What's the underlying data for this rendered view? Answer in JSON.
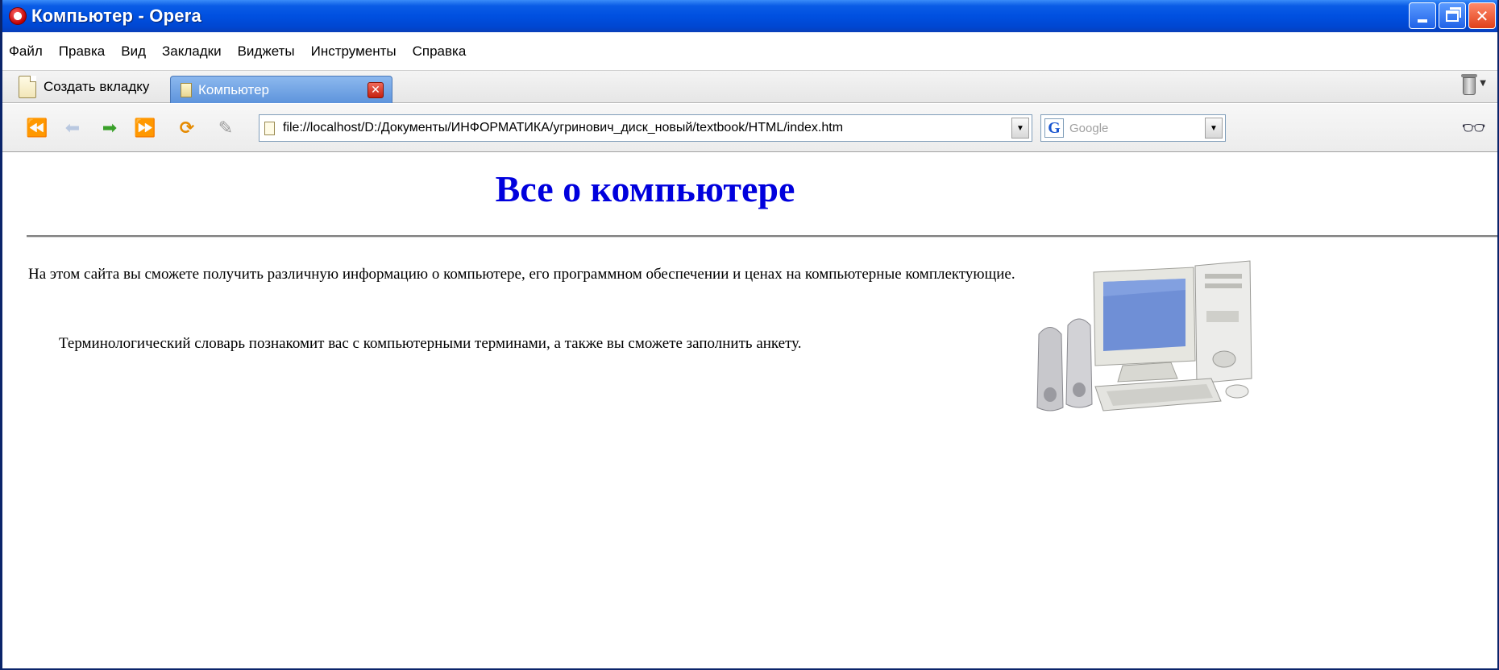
{
  "window": {
    "title": "Компьютер - Opera"
  },
  "menu": {
    "items": [
      "Файл",
      "Правка",
      "Вид",
      "Закладки",
      "Виджеты",
      "Инструменты",
      "Справка"
    ]
  },
  "tabs": {
    "new_tab_label": "Создать вкладку",
    "active_tab_label": "Компьютер"
  },
  "navigation": {
    "address": "file://localhost/D:/Документы/ИНФОРМАТИКА/угринович_диск_новый/textbook/HTML/index.htm",
    "search_placeholder": "Google",
    "search_engine_icon": "G"
  },
  "page": {
    "heading": "Все о компьютере",
    "paragraph1": "На этом сайта вы сможете получить различную информацию о компьютере, его программном обеспечении и ценах на компьютерные комплектующие.",
    "paragraph2": "Терминологический словарь познакомит вас с компьютерными терминами, а также вы сможете заполнить анкету.",
    "image_description": "computer-illustration"
  },
  "colors": {
    "heading": "#0000dd",
    "titlebar": "#0050e0"
  }
}
